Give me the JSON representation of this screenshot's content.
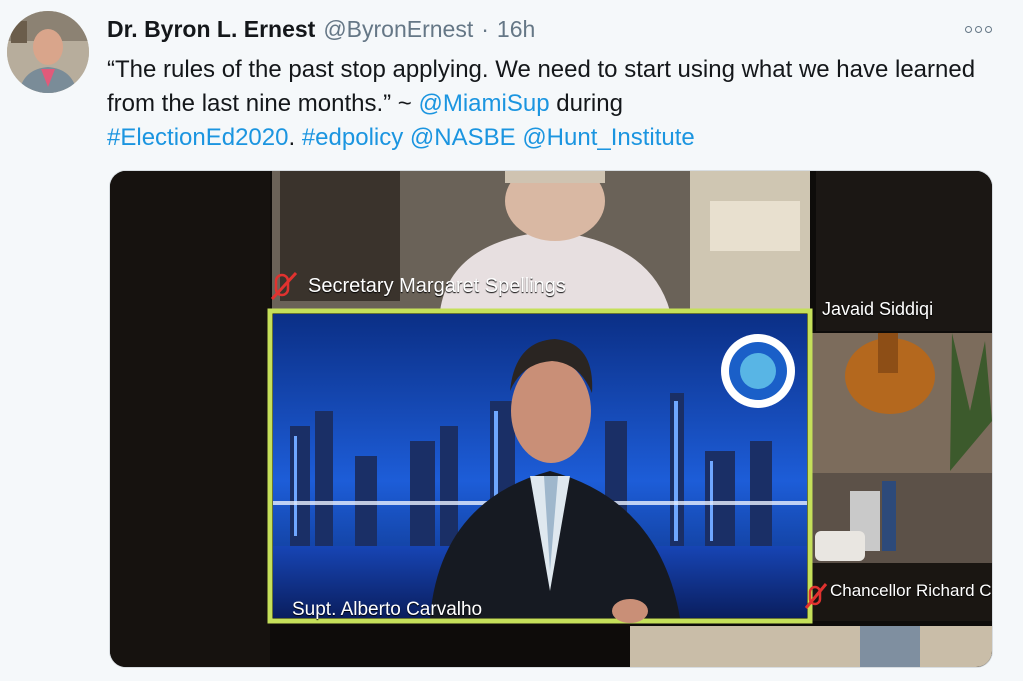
{
  "tweet": {
    "author_name": "Dr. Byron L. Ernest",
    "author_handle": "@ByronErnest",
    "separator": "·",
    "time": "16h",
    "text_part1": "“The rules of the past stop applying. We need to start using what we have learned from the last nine months.” ~ ",
    "mention1": "@MiamiSup",
    "text_part2": " during ",
    "hashtag1": "#ElectionEd2020",
    "text_part3": ". ",
    "hashtag2": "#edpolicy",
    "mention2": "@NASBE",
    "mention3": "@Hunt_Institute"
  },
  "media": {
    "participants": [
      {
        "label": "Secretary Margaret Spellings",
        "muted": true
      },
      {
        "label": "Javaid Siddiqi",
        "muted": false
      },
      {
        "label": "Supt. Alberto Carvalho",
        "muted": false,
        "active_speaker": true
      },
      {
        "label": "Chancellor Richard Ca",
        "muted": true
      }
    ]
  },
  "icons": {
    "more": "more-options-icon",
    "mute": "muted-microphone-icon"
  },
  "colors": {
    "link": "#1b95e0",
    "active_speaker_border": "#c5e05a",
    "muted_icon": "#e0322f"
  }
}
